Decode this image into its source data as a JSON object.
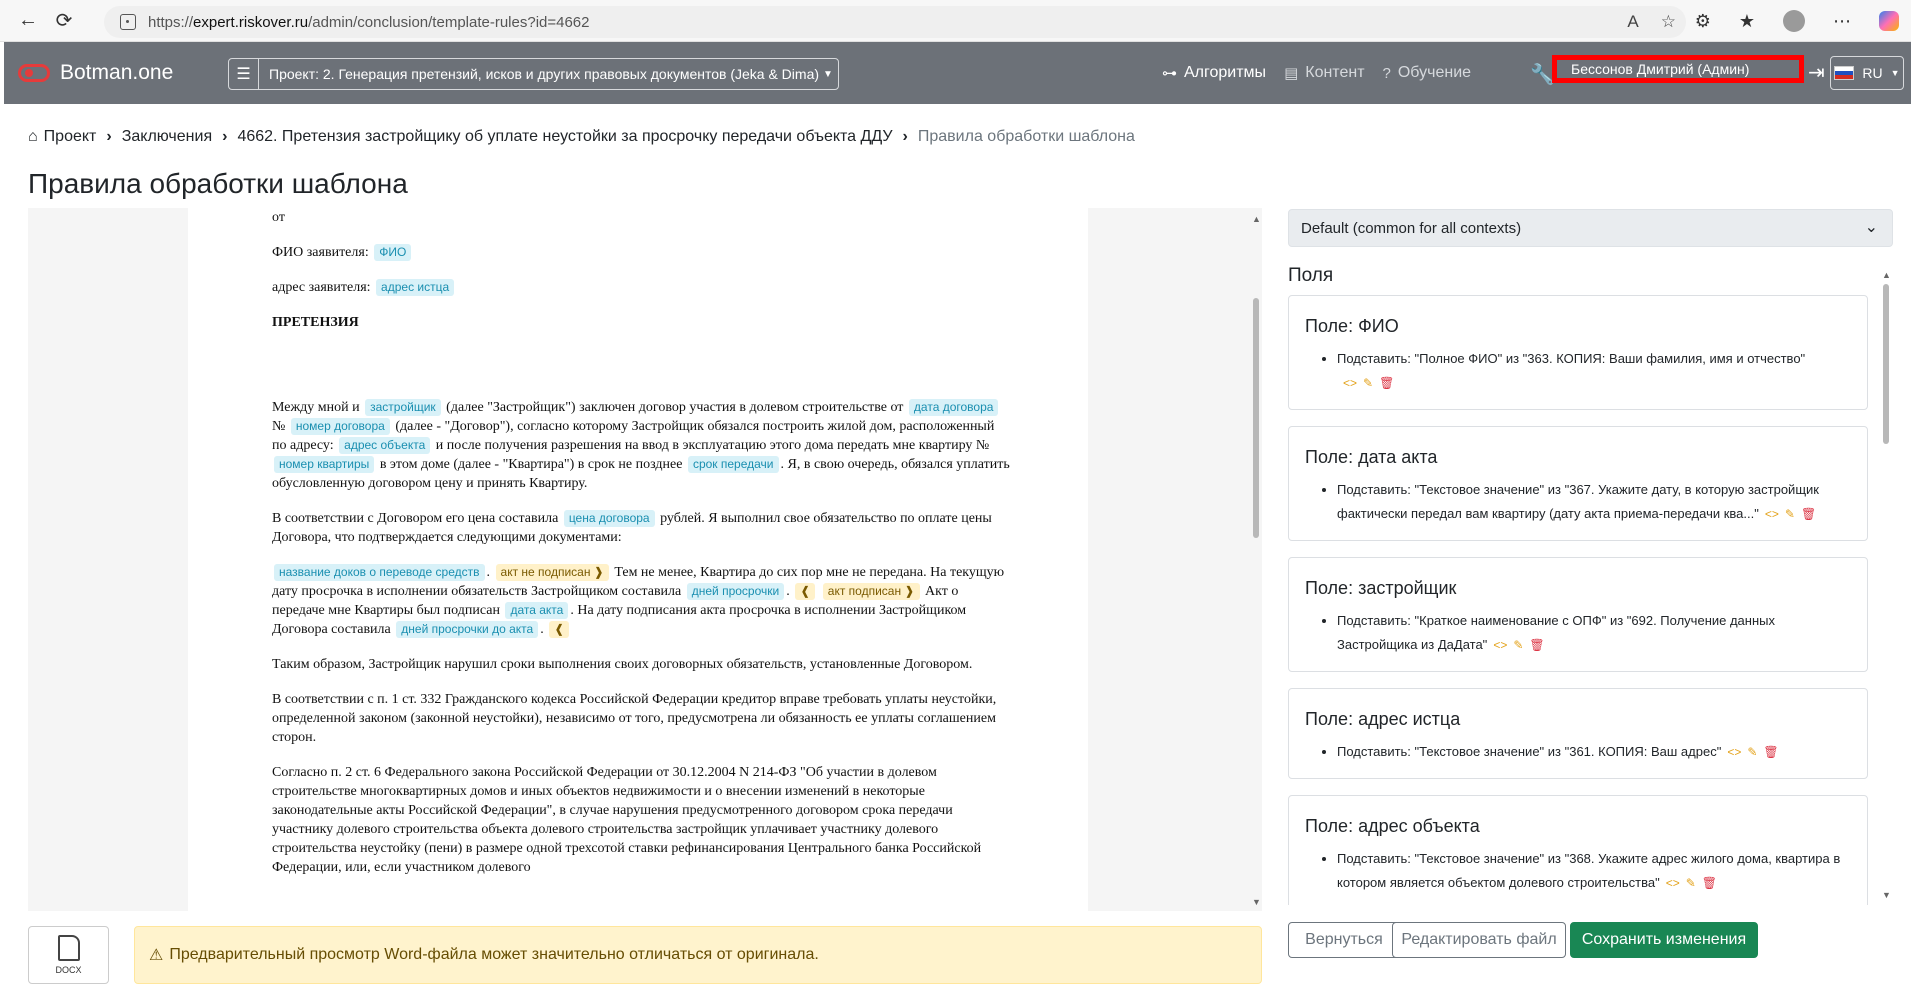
{
  "browser": {
    "url_prefix": "https://",
    "url_host": "expert.riskover.ru",
    "url_path": "/admin/conclusion/template-rules?id=4662"
  },
  "navbar": {
    "brand": "Botman.one",
    "project": "Проект: 2. Генерация претензий, исков и других правовых документов (Jeka & Dima)",
    "links": {
      "algorithms": "Алгоритмы",
      "content": "Контент",
      "training": "Обучение"
    },
    "user": "Бессонов Дмитрий (Админ)",
    "lang": "RU"
  },
  "breadcrumb": {
    "items": [
      "Проект",
      "Заключения",
      "4662. Претензия застройщику об уплате неустойки за просрочку передачи объекта ДДУ",
      "Правила обработки шаблона"
    ]
  },
  "page_title": "Правила обработки шаблона",
  "document": {
    "line_from": "от",
    "fio_label": "ФИО заявителя:",
    "fio_tag": "ФИО",
    "addr_label": "адрес заявителя:",
    "addr_tag": "адрес истца",
    "heading": "ПРЕТЕНЗИЯ",
    "p1": {
      "a": "Между мной и",
      "tag_dev": "застройщик",
      "b": "(далее \"Застройщик\") заключен договор участия в долевом строительстве от",
      "tag_date": "дата договора",
      "c": "№",
      "tag_num": "номер договора",
      "d": "(далее - \"Договор\"), согласно которому Застройщик обязался построить жилой дом, расположенный по адресу:",
      "tag_addr": "адрес объекта",
      "e": "и после получения разрешения на ввод в эксплуатацию этого дома передать мне квартиру №",
      "tag_flat": "номер квартиры",
      "f": "в этом доме (далее - \"Квартира\") в срок не позднее",
      "tag_term": "срок передачи",
      "g": ". Я, в свою очередь, обязался уплатить обусловленную договором цену и принять Квартиру."
    },
    "p2": {
      "a": "В соответствии с Договором его цена составила",
      "tag_price": "цена договора",
      "b": "рублей. Я выполнил свое обязательство по оплате цены Договора, что подтверждается следующими документами:"
    },
    "p3": {
      "tag_docs": "название доков о переводе средств",
      "tag_cond1": "акт не подписан ❱",
      "a": "Тем не менее, Квартира до сих пор мне не передана. На текущую дату просрочка в исполнении обязательств Застройщиком составила",
      "tag_days": "дней просрочки",
      "tag_cond2": "❰",
      "tag_cond3": "акт подписан ❱",
      "b": "Акт о передаче мне Квартиры был подписан",
      "tag_actdate": "дата акта",
      "c": ". На дату подписания акта просрочка в исполнении Застройщиком Договора составила",
      "tag_daysact": "дней просрочки до акта",
      "tag_cond4": "❰"
    },
    "p4": "Таким образом, Застройщик нарушил сроки выполнения своих договорных обязательств, установленные Договором.",
    "p5": "В соответствии с п. 1 ст. 332 Гражданского кодекса Российской Федерации кредитор вправе требовать уплаты неустойки, определенной законом (законной неустойки), независимо от того, предусмотрена ли обязанность ее уплаты соглашением сторон.",
    "p6": "Согласно п. 2 ст. 6 Федерального закона Российской Федерации от 30.12.2004 N 214-ФЗ \"Об участии в долевом строительстве многоквартирных домов и иных объектов недвижимости и о внесении изменений в некоторые законодательные акты Российской Федерации\", в случае нарушения предусмотренного договором срока передачи участнику долевого строительства объекта долевого строительства застройщик уплачивает участнику долевого строительства неустойку (пени) в размере одной трехсотой ставки рефинансирования Центрального банка Российской Федерации, или, если участником долевого"
  },
  "context_select": "Default (common for all contexts)",
  "fields_title": "Поля",
  "fields": [
    {
      "title": "Поле: ФИО",
      "rule": "Подставить: \"Полное ФИО\" из \"363. КОПИЯ: Ваши фамилия, имя и отчество\""
    },
    {
      "title": "Поле: дата акта",
      "rule": "Подставить: \"Текстовое значение\" из \"367. Укажите дату, в которую застройщик фактически передал вам квартиру (дату акта приема-передачи ква...\""
    },
    {
      "title": "Поле: застройщик",
      "rule": "Подставить: \"Краткое наименование с ОПФ\" из \"692. Получение данных Застройщика из ДаДата\""
    },
    {
      "title": "Поле: адрес истца",
      "rule": "Подставить: \"Текстовое значение\" из \"361. КОПИЯ: Ваш адрес\""
    },
    {
      "title": "Поле: адрес объекта",
      "rule": "Подставить: \"Текстовое значение\" из \"368. Укажите адрес жилого дома, квартира в котором является объектом долевого строительства\""
    }
  ],
  "icons": {
    "code": "code-icon",
    "edit": "pencil-icon",
    "delete": "trash-icon"
  },
  "footer": {
    "docx_label": "DOCX",
    "alert": "Предварительный просмотр Word-файла может значительно отличаться от оригинала.",
    "back": "Вернуться",
    "edit_file": "Редактировать файл",
    "save": "Сохранить изменения"
  },
  "colors": {
    "navbar": "#6c7178",
    "save": "#198754",
    "tag": "#d8f1f8",
    "tag_cond": "#fff1c9",
    "alert": "#fff3cd"
  }
}
